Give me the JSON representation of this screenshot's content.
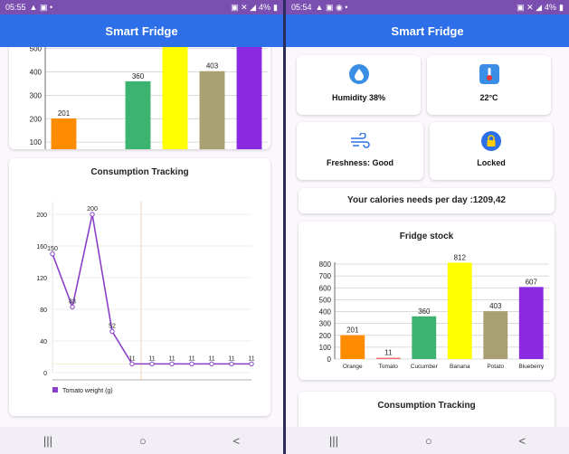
{
  "left": {
    "status": {
      "time": "05:55",
      "battery": "4%"
    },
    "title": "Smart Fridge",
    "consumption_title": "Consumption Tracking"
  },
  "right": {
    "status": {
      "time": "05:54",
      "battery": "4%"
    },
    "title": "Smart Fridge",
    "tiles": {
      "humidity": "Humidity 38%",
      "temperature": "22°C",
      "freshness": "Freshness: Good",
      "lock": "Locked"
    },
    "calories": "Your calories needs per day  :1209,42",
    "stock_title": "Fridge stock",
    "consumption_title": "Consumption Tracking"
  },
  "icons": {
    "humidity": "water-drop-icon",
    "temperature": "thermometer-icon",
    "freshness": "wind-icon",
    "lock": "padlock-icon"
  },
  "nav": {
    "recents": "|||",
    "home": "○",
    "back": "<"
  },
  "chart_data": [
    {
      "type": "bar",
      "title": "Fridge stock",
      "categories": [
        "Orange",
        "Tomato",
        "Cucumber",
        "Banana",
        "Potato",
        "Blueberry"
      ],
      "values": [
        201,
        11,
        360,
        812,
        403,
        607
      ],
      "colors": [
        "#ff8c00",
        "#ff6b6b",
        "#3cb371",
        "#ffff00",
        "#a89f72",
        "#8a2be2"
      ],
      "ylim": [
        0,
        800
      ],
      "yticks": [
        0,
        100,
        200,
        300,
        400,
        500,
        600,
        700,
        800
      ]
    },
    {
      "type": "line",
      "title": "Consumption Tracking",
      "series": [
        {
          "name": "Tomato weight (g)",
          "values": [
            150,
            83,
            200,
            52,
            11,
            11,
            11,
            11,
            11,
            11,
            11
          ],
          "color": "#8a3fc8"
        }
      ],
      "point_labels": [
        "150",
        "83",
        "200",
        "52",
        "11",
        "11",
        "11",
        "11",
        "11",
        "11",
        "11"
      ],
      "ylim": [
        0,
        200
      ],
      "yticks": [
        0,
        40,
        80,
        120,
        160,
        200
      ]
    }
  ]
}
